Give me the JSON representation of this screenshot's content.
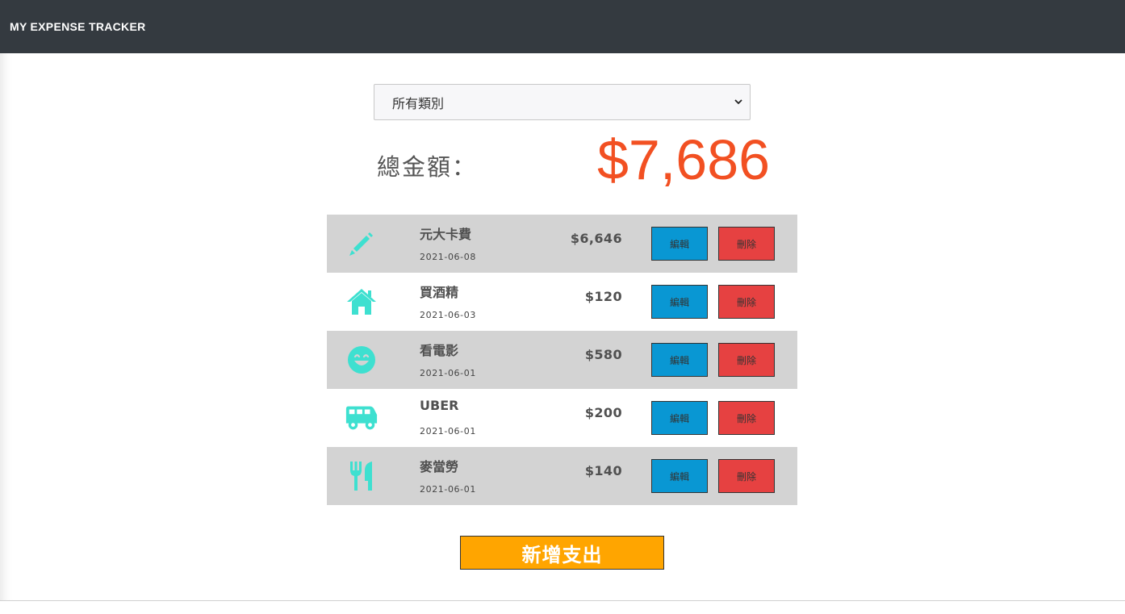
{
  "navbar": {
    "brand": "MY EXPENSE TRACKER"
  },
  "filter": {
    "selected": "所有類別"
  },
  "total": {
    "label": "總金額：",
    "amount": "$7,686"
  },
  "colors": {
    "navbar": "#343a40",
    "accent_total": "#f25022",
    "icon": "#3ee0d0",
    "edit_button": "#0997d3",
    "delete_button": "#e64141",
    "add_button": "#ffa500",
    "row_shade": "#d3d3d3"
  },
  "records": [
    {
      "icon": "pencil-icon",
      "name": "元大卡費",
      "date": "2021-06-08",
      "amount": "$6,646",
      "edit_label": "編輯",
      "delete_label": "刪除"
    },
    {
      "icon": "home-icon",
      "name": "買酒精",
      "date": "2021-06-03",
      "amount": "$120",
      "edit_label": "編輯",
      "delete_label": "刪除"
    },
    {
      "icon": "smile-icon",
      "name": "看電影",
      "date": "2021-06-01",
      "amount": "$580",
      "edit_label": "編輯",
      "delete_label": "刪除"
    },
    {
      "icon": "van-icon",
      "name": "UBER",
      "date": "2021-06-01",
      "amount": "$200",
      "edit_label": "編輯",
      "delete_label": "刪除"
    },
    {
      "icon": "utensils-icon",
      "name": "麥當勞",
      "date": "2021-06-01",
      "amount": "$140",
      "edit_label": "編輯",
      "delete_label": "刪除"
    }
  ],
  "add_button": {
    "label": "新增支出"
  }
}
